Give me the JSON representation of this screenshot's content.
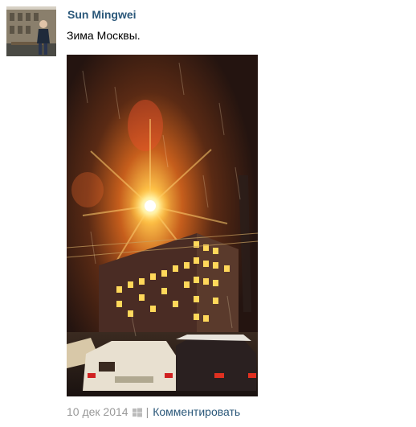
{
  "post": {
    "author": "Sun Mingwei",
    "text": "Зима Москвы.",
    "date": "10 дек 2014",
    "separator": "|",
    "comment_label": "Комментировать"
  },
  "icons": {
    "avatar": "user-photo-avatar",
    "platform": "windows-icon"
  },
  "colors": {
    "link": "#2b587a",
    "meta": "#999999",
    "platform_icon": "#bbbbbb"
  }
}
